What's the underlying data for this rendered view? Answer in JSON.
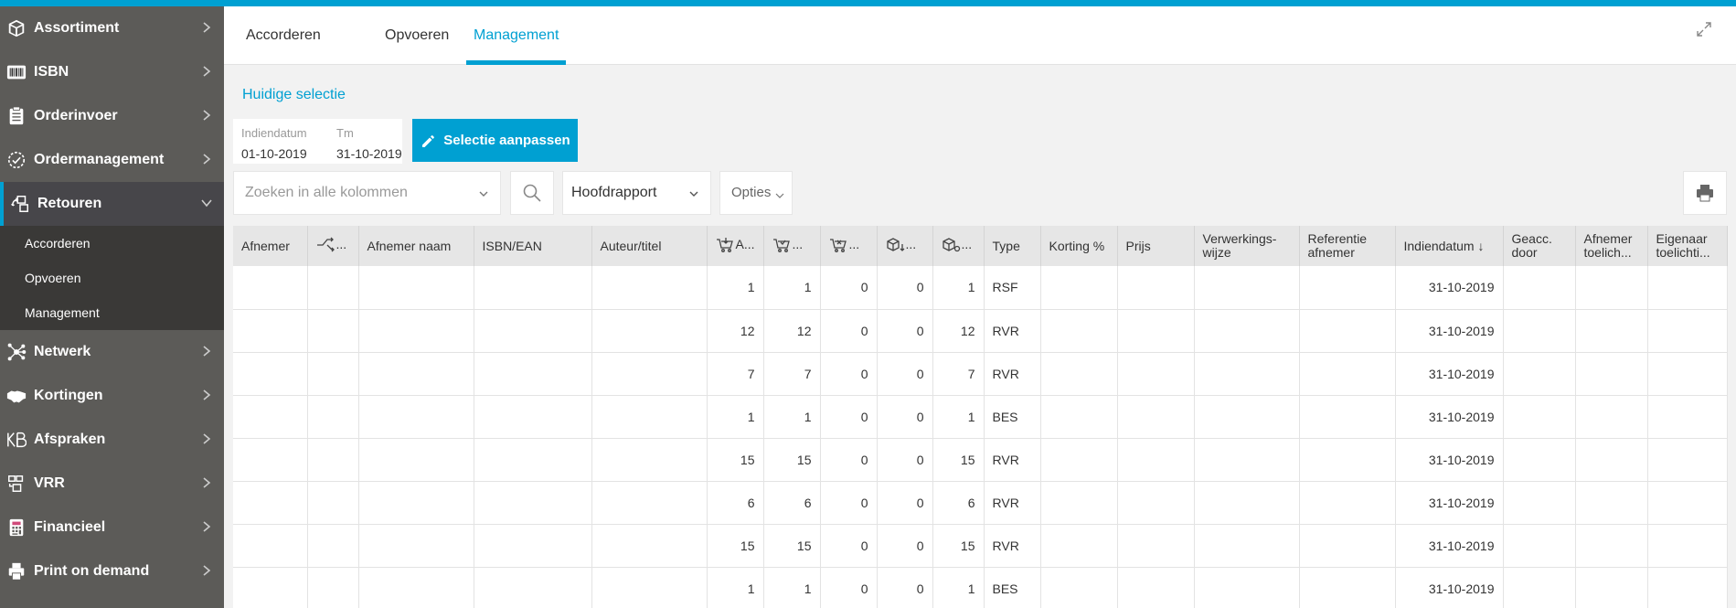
{
  "sidebar": {
    "items": [
      {
        "label": "Assortiment",
        "icon": "box-icon"
      },
      {
        "label": "ISBN",
        "icon": "barcode-icon"
      },
      {
        "label": "Orderinvoer",
        "icon": "clipboard-icon"
      },
      {
        "label": "Ordermanagement",
        "icon": "check-circle-icon"
      },
      {
        "label": "Retouren",
        "icon": "return-boxes-icon"
      },
      {
        "label": "Netwerk",
        "icon": "network-icon"
      },
      {
        "label": "Kortingen",
        "icon": "handshake-icon"
      },
      {
        "label": "Afspraken",
        "icon": "kb-logo-icon"
      },
      {
        "label": "VRR",
        "icon": "vrr-icon"
      },
      {
        "label": "Financieel",
        "icon": "calculator-icon"
      },
      {
        "label": "Print on demand",
        "icon": "printer-icon"
      }
    ],
    "subitems": [
      "Accorderen",
      "Opvoeren",
      "Management"
    ]
  },
  "tabs": [
    "Accorderen",
    "Opvoeren",
    "Management"
  ],
  "selection": {
    "title": "Huidige selectie",
    "from_label": "Indiendatum",
    "from_value": "01-10-2019",
    "to_label": "Tm",
    "to_value": "31-10-2019",
    "button": "Selectie aanpassen"
  },
  "toolbar": {
    "search_placeholder": "Zoeken in alle kolommen",
    "report": "Hoofdrapport",
    "options": "Opties"
  },
  "table": {
    "headers": {
      "afnemer": "Afnemer",
      "icon_col": "...",
      "afnemer_naam": "Afnemer naam",
      "isbn": "ISBN/EAN",
      "auteur": "Auteur/titel",
      "c1": "A...",
      "c2": "...",
      "c3": "...",
      "c4": "...",
      "c5": "...",
      "type": "Type",
      "korting": "Korting %",
      "prijs": "Prijs",
      "verwerking": "Verwerkings-wijze",
      "referentie": "Referentie afnemer",
      "indiendatum": "Indiendatum ↓",
      "geacc": "Geacc. door",
      "afnemer_toel": "Afnemer toelich...",
      "eigenaar_toel": "Eigenaar toelichti..."
    },
    "rows": [
      {
        "c1": "1",
        "c2": "1",
        "c3": "0",
        "c4": "0",
        "c5": "1",
        "type": "RSF",
        "date": "31-10-2019"
      },
      {
        "c1": "12",
        "c2": "12",
        "c3": "0",
        "c4": "0",
        "c5": "12",
        "type": "RVR",
        "date": "31-10-2019"
      },
      {
        "c1": "7",
        "c2": "7",
        "c3": "0",
        "c4": "0",
        "c5": "7",
        "type": "RVR",
        "date": "31-10-2019"
      },
      {
        "c1": "1",
        "c2": "1",
        "c3": "0",
        "c4": "0",
        "c5": "1",
        "type": "BES",
        "date": "31-10-2019"
      },
      {
        "c1": "15",
        "c2": "15",
        "c3": "0",
        "c4": "0",
        "c5": "15",
        "type": "RVR",
        "date": "31-10-2019"
      },
      {
        "c1": "6",
        "c2": "6",
        "c3": "0",
        "c4": "0",
        "c5": "6",
        "type": "RVR",
        "date": "31-10-2019"
      },
      {
        "c1": "15",
        "c2": "15",
        "c3": "0",
        "c4": "0",
        "c5": "15",
        "type": "RVR",
        "date": "31-10-2019"
      },
      {
        "c1": "1",
        "c2": "1",
        "c3": "0",
        "c4": "0",
        "c5": "1",
        "type": "BES",
        "date": "31-10-2019"
      }
    ]
  }
}
